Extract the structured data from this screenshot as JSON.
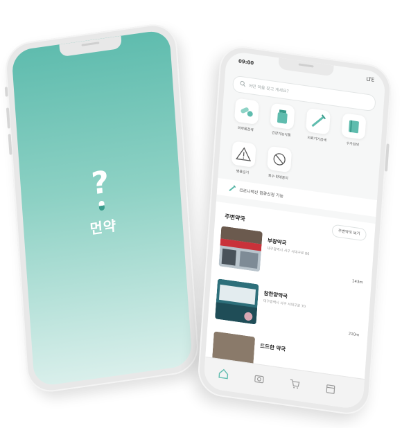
{
  "splash": {
    "mark": "?",
    "app_name": "먼약"
  },
  "app": {
    "status": {
      "time": "09:00",
      "network": "LTE"
    },
    "search": {
      "placeholder": "어떤 약을 찾고 계세요?"
    },
    "categories": [
      {
        "icon": "pills-icon",
        "label": "의약품검색"
      },
      {
        "icon": "supplement-bottle-icon",
        "label": "건강기능식품"
      },
      {
        "icon": "syringe-icon",
        "label": "의료기기검색"
      },
      {
        "icon": "book-icon",
        "label": "수가검색"
      },
      {
        "icon": "warning-icon",
        "label": "병용금기"
      },
      {
        "icon": "prohibited-icon",
        "label": "회수·판매중지"
      }
    ],
    "notice": "코로나백신 접종신청 가능",
    "nearby": {
      "title": "주변약국",
      "more_label": "주변약국 보기",
      "pharmacies": [
        {
          "name": "부광약국",
          "address": "대구광역시 서구 서대구로 86",
          "distance": "143m"
        },
        {
          "name": "참한양약국",
          "address": "대구광역시 서구 서대구로 70",
          "distance": "210m"
        },
        {
          "name": "드드한 약국"
        }
      ]
    },
    "tabs": [
      "home-icon",
      "camera-icon",
      "cart-icon",
      "calendar-icon"
    ],
    "colors": {
      "primary": "#5fbcae",
      "accent": "#3a9c8c"
    }
  }
}
